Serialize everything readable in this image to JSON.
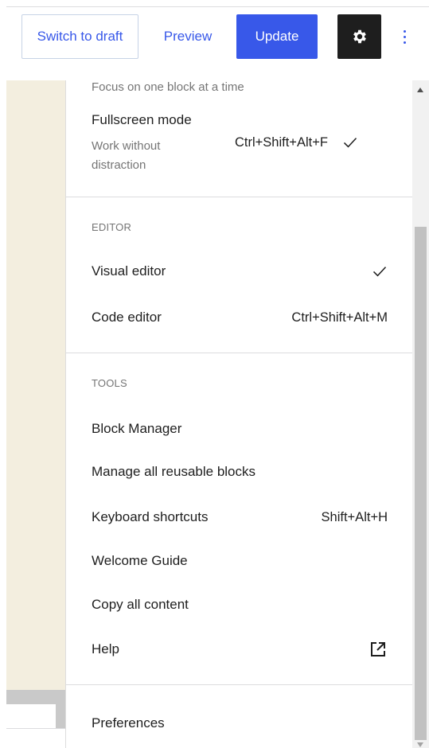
{
  "header": {
    "switch_to_draft": "Switch to draft",
    "preview": "Preview",
    "update": "Update",
    "settings_icon": "gear-icon",
    "options_icon": "vertical-ellipsis-icon"
  },
  "menu": {
    "view": {
      "spotlight_desc": "Focus on one block at a time",
      "fullscreen": {
        "label": "Fullscreen mode",
        "desc_line1": "Work without",
        "desc_line2": "distraction",
        "shortcut": "Ctrl+Shift+Alt+F",
        "checked": true
      }
    },
    "editor": {
      "group_label": "EDITOR",
      "visual_editor": {
        "label": "Visual editor",
        "checked": true
      },
      "code_editor": {
        "label": "Code editor",
        "shortcut": "Ctrl+Shift+Alt+M"
      }
    },
    "tools": {
      "group_label": "TOOLS",
      "block_manager": "Block Manager",
      "manage_reusable": "Manage all reusable blocks",
      "keyboard_shortcuts": {
        "label": "Keyboard shortcuts",
        "shortcut": "Shift+Alt+H"
      },
      "welcome_guide": "Welcome Guide",
      "copy_all": "Copy all content",
      "help": {
        "label": "Help",
        "icon": "external-link-icon"
      }
    },
    "preferences": "Preferences"
  },
  "colors": {
    "accent": "#3858e9",
    "dark": "#1e1e1e",
    "muted": "#757575",
    "canvas": "#f3eedf"
  }
}
